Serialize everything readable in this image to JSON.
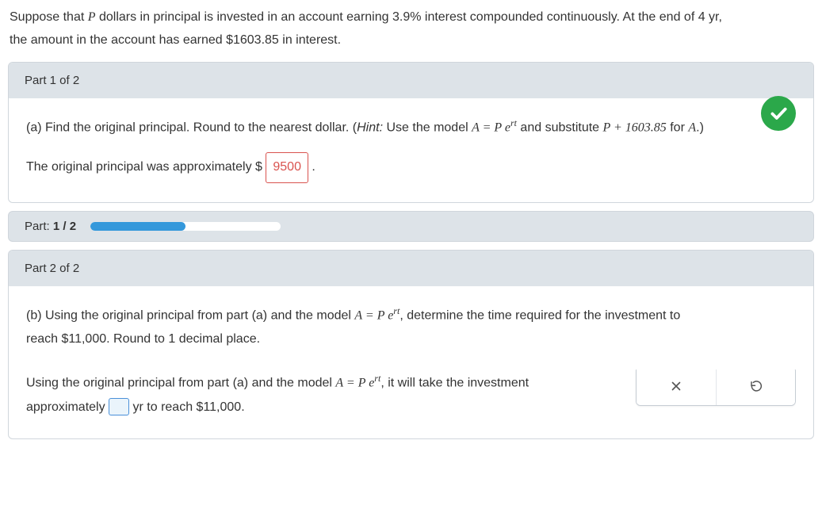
{
  "problem": {
    "line1_prefix": "Suppose that ",
    "var_P": "P",
    "line1_mid": " dollars in principal is invested in an account earning ",
    "rate": "3.9%",
    "line1_suffix": " interest compounded continuously. At the end of ",
    "years": "4",
    "line1_end": " yr,",
    "line2_prefix": "the amount in the account has earned ",
    "interest": "$1603.85",
    "line2_suffix": " in interest."
  },
  "part1": {
    "header": "Part 1 of 2",
    "q_prefix": "(a) Find the original principal. Round to the nearest dollar. (",
    "hint_label": "Hint:",
    "hint_text": " Use the model ",
    "model": "A = P e",
    "model_exp": "rt",
    "hint_mid": " and substitute ",
    "hint_sub": "P + 1603.85",
    "hint_for": " for ",
    "hint_A": "A",
    "hint_end": ".)",
    "ans_prefix": "The original principal was approximately $",
    "ans_value": "9500",
    "ans_suffix": "."
  },
  "progress": {
    "label_prefix": "Part: ",
    "label_bold": "1 / 2",
    "fill_percent": 50
  },
  "part2": {
    "header": "Part 2 of 2",
    "q_prefix": "(b) Using the original principal from part (a) and the model ",
    "model": "A = P e",
    "model_exp": "rt",
    "q_mid": ", determine the time required for the investment to",
    "q_line2_prefix": "reach ",
    "target": "$11,000",
    "q_line2_suffix": ". Round to ",
    "decimal": "1",
    "q_line2_end": " decimal place.",
    "ans_prefix": "Using the original principal from part (a) and the model ",
    "ans_mid": ", it will take the investment",
    "ans_line2_prefix": "approximately ",
    "ans_line2_mid": " yr to reach ",
    "ans_target": "$11,000",
    "ans_line2_end": "."
  }
}
